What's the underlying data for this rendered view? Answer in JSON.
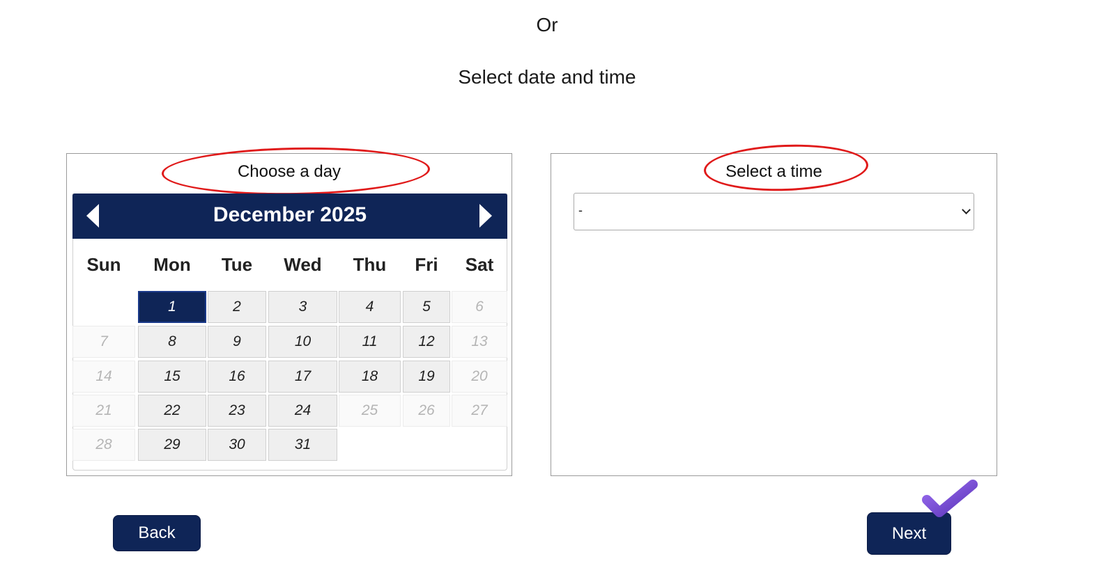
{
  "headings": {
    "or": "Or",
    "select_date_time": "Select date and time"
  },
  "day_panel": {
    "label": "Choose a day",
    "calendar": {
      "month_title": "December 2025",
      "weekdays": [
        "Sun",
        "Mon",
        "Tue",
        "Wed",
        "Thu",
        "Fri",
        "Sat"
      ],
      "rows": [
        [
          {
            "d": "",
            "s": "blank"
          },
          {
            "d": "1",
            "s": "selected"
          },
          {
            "d": "2",
            "s": "active"
          },
          {
            "d": "3",
            "s": "active"
          },
          {
            "d": "4",
            "s": "active"
          },
          {
            "d": "5",
            "s": "active"
          },
          {
            "d": "6",
            "s": "disabled"
          }
        ],
        [
          {
            "d": "7",
            "s": "disabled"
          },
          {
            "d": "8",
            "s": "active"
          },
          {
            "d": "9",
            "s": "active"
          },
          {
            "d": "10",
            "s": "active"
          },
          {
            "d": "11",
            "s": "active"
          },
          {
            "d": "12",
            "s": "active"
          },
          {
            "d": "13",
            "s": "disabled"
          }
        ],
        [
          {
            "d": "14",
            "s": "disabled"
          },
          {
            "d": "15",
            "s": "active"
          },
          {
            "d": "16",
            "s": "active"
          },
          {
            "d": "17",
            "s": "active"
          },
          {
            "d": "18",
            "s": "active"
          },
          {
            "d": "19",
            "s": "active"
          },
          {
            "d": "20",
            "s": "disabled"
          }
        ],
        [
          {
            "d": "21",
            "s": "disabled"
          },
          {
            "d": "22",
            "s": "active"
          },
          {
            "d": "23",
            "s": "active"
          },
          {
            "d": "24",
            "s": "active"
          },
          {
            "d": "25",
            "s": "disabled"
          },
          {
            "d": "26",
            "s": "disabled"
          },
          {
            "d": "27",
            "s": "disabled"
          }
        ],
        [
          {
            "d": "28",
            "s": "disabled"
          },
          {
            "d": "29",
            "s": "active"
          },
          {
            "d": "30",
            "s": "active"
          },
          {
            "d": "31",
            "s": "active"
          },
          {
            "d": "",
            "s": "blank"
          },
          {
            "d": "",
            "s": "blank"
          },
          {
            "d": "",
            "s": "blank"
          }
        ]
      ],
      "prev_icon": "chevron-left-icon",
      "next_icon": "chevron-right-icon"
    }
  },
  "time_panel": {
    "label": "Select a time",
    "select_value": "-"
  },
  "buttons": {
    "back": "Back",
    "next": "Next"
  },
  "colors": {
    "navy": "#0f2557",
    "annotation_red": "#e01a1a",
    "check_purple": "#7b4fd6"
  }
}
